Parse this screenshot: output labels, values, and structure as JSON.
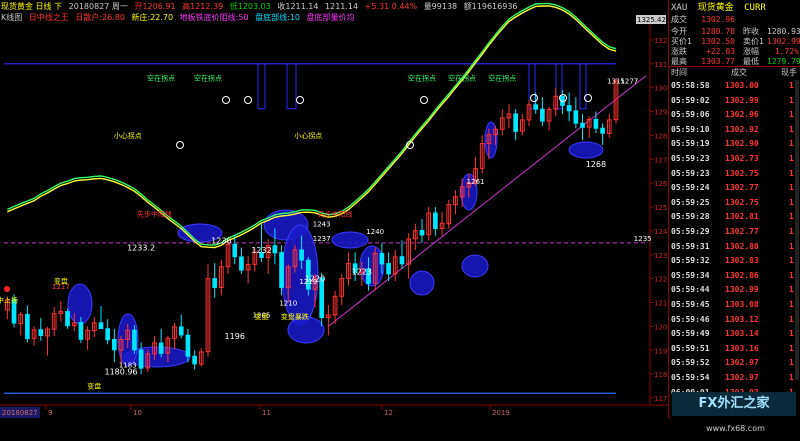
{
  "infobar": {
    "title": "现货黄金 日线 下",
    "date": "20180827 周一",
    "open": "开1206.91",
    "high": "高1212.39",
    "low": "低1203.03",
    "close": "收1211.14",
    "last": "1211.14",
    "change": "+5.31 0.44%",
    "volume": "量99138",
    "amount": "额119616936"
  },
  "indbar": {
    "name": "K线图",
    "sub": "日中线之王",
    "v1": "日散户:26.80",
    "v2": "新庄:22.70",
    "v3": "地板铁底价阻线:50",
    "v4": "盘底部线:10",
    "v5": "盘底部量价均"
  },
  "colors": {
    "bg": "#000000",
    "up": "#ff3333",
    "down": "#00e5ff",
    "ma_yellow": "#ffff33",
    "ma_green": "#33ff66",
    "blue_line": "#2a2aff",
    "mag_line": "#cc33cc",
    "ellipse": "#1a1acc",
    "axis_red": "#8b0000"
  },
  "chart_data": {
    "type": "candlestick",
    "y_range": [
      1170,
      1325
    ],
    "y_ticks": [
      1320,
      1310,
      1300,
      1290,
      1280,
      1270,
      1260,
      1250,
      1240,
      1230,
      1220,
      1210,
      1200,
      1190,
      1180,
      1170
    ],
    "top_value_label": "1325.42",
    "x_labels": [
      "20180827",
      "9",
      "10",
      "11",
      "12",
      "2019"
    ],
    "ohlc": [
      [
        1206.9,
        1212.4,
        1203.0,
        1211.1
      ],
      [
        1211.1,
        1213.5,
        1199.5,
        1201.4
      ],
      [
        1201.2,
        1206.0,
        1196.2,
        1205.0
      ],
      [
        1205.0,
        1208.8,
        1193.4,
        1194.9
      ],
      [
        1195.0,
        1200.0,
        1192.0,
        1198.5
      ],
      [
        1198.6,
        1203.5,
        1194.0,
        1196.2
      ],
      [
        1196.0,
        1199.8,
        1187.8,
        1198.9
      ],
      [
        1198.8,
        1208.2,
        1196.0,
        1205.3
      ],
      [
        1205.4,
        1210.6,
        1202.0,
        1206.3
      ],
      [
        1206.2,
        1207.5,
        1199.0,
        1200.3
      ],
      [
        1200.3,
        1205.5,
        1198.0,
        1201.5
      ],
      [
        1201.6,
        1204.0,
        1193.0,
        1194.6
      ],
      [
        1194.7,
        1200.1,
        1190.2,
        1198.3
      ],
      [
        1198.2,
        1203.9,
        1195.5,
        1201.5
      ],
      [
        1201.5,
        1208.5,
        1199.0,
        1199.1
      ],
      [
        1199.0,
        1203.0,
        1192.5,
        1194.4
      ],
      [
        1194.5,
        1199.0,
        1185.0,
        1190.2
      ],
      [
        1190.0,
        1196.0,
        1183.0,
        1194.5
      ],
      [
        1194.5,
        1201.0,
        1191.0,
        1198.4
      ],
      [
        1198.4,
        1200.5,
        1188.5,
        1190.2
      ],
      [
        1190.1,
        1193.3,
        1180.0,
        1182.5
      ],
      [
        1182.6,
        1190.2,
        1180.8,
        1188.5
      ],
      [
        1188.5,
        1196.0,
        1186.0,
        1193.1
      ],
      [
        1193.0,
        1199.0,
        1187.0,
        1188.7
      ],
      [
        1188.8,
        1196.0,
        1185.0,
        1195.0
      ],
      [
        1195.0,
        1201.5,
        1190.4,
        1199.8
      ],
      [
        1199.8,
        1205.0,
        1195.0,
        1196.4
      ],
      [
        1196.3,
        1199.0,
        1185.0,
        1187.5
      ],
      [
        1187.5,
        1190.0,
        1182.0,
        1184.3
      ],
      [
        1184.2,
        1191.0,
        1183.3,
        1189.3
      ],
      [
        1189.4,
        1226.0,
        1187.2,
        1220.0
      ],
      [
        1220.0,
        1226.5,
        1212.0,
        1216.3
      ],
      [
        1216.3,
        1228.0,
        1213.0,
        1225.0
      ],
      [
        1225.0,
        1236.0,
        1222.0,
        1234.3
      ],
      [
        1234.4,
        1238.5,
        1226.0,
        1229.2
      ],
      [
        1229.1,
        1233.0,
        1222.0,
        1223.6
      ],
      [
        1223.7,
        1229.5,
        1218.0,
        1225.9
      ],
      [
        1226.0,
        1233.0,
        1223.0,
        1231.1
      ],
      [
        1231.0,
        1243.0,
        1227.0,
        1228.9
      ],
      [
        1228.9,
        1236.5,
        1222.0,
        1233.8
      ],
      [
        1233.8,
        1241.0,
        1226.0,
        1230.8
      ],
      [
        1230.9,
        1234.0,
        1213.0,
        1216.3
      ],
      [
        1216.2,
        1226.0,
        1210.0,
        1224.9
      ],
      [
        1225.0,
        1234.0,
        1222.5,
        1232.1
      ],
      [
        1232.0,
        1238.0,
        1224.0,
        1227.8
      ],
      [
        1227.7,
        1229.0,
        1213.0,
        1215.6
      ],
      [
        1215.5,
        1222.0,
        1208.0,
        1220.3
      ],
      [
        1220.3,
        1222.5,
        1200.0,
        1203.7
      ],
      [
        1203.7,
        1209.0,
        1196.2,
        1204.8
      ],
      [
        1204.8,
        1215.0,
        1201.0,
        1212.6
      ],
      [
        1212.6,
        1222.0,
        1209.0,
        1220.0
      ],
      [
        1220.1,
        1231.0,
        1217.0,
        1226.3
      ],
      [
        1226.2,
        1231.0,
        1219.0,
        1222.5
      ],
      [
        1222.6,
        1227.0,
        1217.0,
        1224.0
      ],
      [
        1224.1,
        1229.0,
        1215.0,
        1218.0
      ],
      [
        1218.1,
        1233.0,
        1215.0,
        1230.6
      ],
      [
        1230.5,
        1235.0,
        1222.0,
        1226.2
      ],
      [
        1226.3,
        1231.0,
        1219.0,
        1222.0
      ],
      [
        1222.0,
        1232.0,
        1219.0,
        1229.1
      ],
      [
        1229.2,
        1236.0,
        1224.0,
        1226.2
      ],
      [
        1226.1,
        1239.0,
        1220.0,
        1236.6
      ],
      [
        1236.7,
        1243.0,
        1232.0,
        1240.1
      ],
      [
        1240.2,
        1245.0,
        1235.0,
        1238.3
      ],
      [
        1238.4,
        1250.0,
        1236.0,
        1247.5
      ],
      [
        1247.5,
        1250.0,
        1238.0,
        1241.0
      ],
      [
        1241.0,
        1248.0,
        1238.0,
        1243.2
      ],
      [
        1243.0,
        1253.0,
        1241.0,
        1251.0
      ],
      [
        1251.0,
        1257.0,
        1247.0,
        1254.3
      ],
      [
        1254.3,
        1262.0,
        1250.0,
        1258.5
      ],
      [
        1258.4,
        1264.0,
        1254.0,
        1260.3
      ],
      [
        1260.3,
        1271.0,
        1259.0,
        1266.1
      ],
      [
        1266.2,
        1280.0,
        1264.0,
        1276.6
      ],
      [
        1276.6,
        1283.0,
        1270.0,
        1280.3
      ],
      [
        1280.3,
        1284.0,
        1276.0,
        1282.6
      ],
      [
        1282.6,
        1291.0,
        1280.0,
        1287.3
      ],
      [
        1287.4,
        1293.0,
        1283.0,
        1289.0
      ],
      [
        1289.0,
        1291.0,
        1278.0,
        1281.7
      ],
      [
        1281.8,
        1289.0,
        1280.0,
        1286.5
      ],
      [
        1286.5,
        1295.0,
        1284.0,
        1292.8
      ],
      [
        1292.8,
        1298.0,
        1289.0,
        1291.0
      ],
      [
        1291.0,
        1296.0,
        1284.0,
        1286.0
      ],
      [
        1286.0,
        1292.0,
        1282.0,
        1290.9
      ],
      [
        1291.0,
        1300.0,
        1288.0,
        1296.4
      ],
      [
        1296.4,
        1299.0,
        1289.0,
        1292.6
      ],
      [
        1292.5,
        1298.0,
        1286.0,
        1290.3
      ],
      [
        1290.3,
        1296.0,
        1283.0,
        1285.1
      ],
      [
        1285.1,
        1289.0,
        1278.0,
        1283.4
      ],
      [
        1283.5,
        1288.0,
        1279.0,
        1286.7
      ],
      [
        1286.7,
        1290.0,
        1281.0,
        1283.0
      ],
      [
        1283.0,
        1285.0,
        1276.0,
        1280.9
      ],
      [
        1280.8,
        1289.0,
        1279.0,
        1286.5
      ],
      [
        1286.6,
        1304.0,
        1285.0,
        1302.9
      ]
    ],
    "ma_yellow": [
      1208,
      1207,
      1206,
      1205,
      1204,
      1204,
      1203.5,
      1203.5,
      1203.5,
      1203,
      1203,
      1202.5,
      1202,
      1202,
      1202,
      1201.5,
      1201,
      1200.5,
      1200,
      1199.5,
      1198.5,
      1197.5,
      1197,
      1196.5,
      1196,
      1196,
      1196,
      1195.5,
      1195,
      1195,
      1197,
      1199,
      1202,
      1206,
      1209,
      1212,
      1215,
      1218,
      1221,
      1223,
      1225,
      1226,
      1226.5,
      1227,
      1227.5,
      1227,
      1226,
      1224,
      1222,
      1221,
      1220.5,
      1220.5,
      1221,
      1221.5,
      1222,
      1223,
      1224,
      1225,
      1226,
      1227,
      1228.5,
      1230,
      1231.5,
      1233,
      1235,
      1237,
      1239,
      1241.5,
      1244,
      1247,
      1250.5,
      1254,
      1258,
      1262,
      1266,
      1270,
      1273,
      1276,
      1279,
      1282,
      1284,
      1286,
      1287.5,
      1288.5,
      1289,
      1289,
      1288.5,
      1288,
      1287.5,
      1287,
      1287,
      1288
    ],
    "ma_green": [
      1209,
      1208,
      1207,
      1206,
      1205,
      1205,
      1204.5,
      1204.5,
      1204.5,
      1204,
      1204,
      1203.5,
      1203,
      1203,
      1203,
      1202.5,
      1202,
      1201.5,
      1201,
      1200.5,
      1199.5,
      1198.5,
      1198,
      1197.5,
      1197,
      1197,
      1197,
      1196.5,
      1196,
      1196,
      1198,
      1200,
      1203,
      1207,
      1210,
      1213,
      1216,
      1219,
      1222,
      1224,
      1226,
      1227,
      1227.5,
      1228,
      1228.5,
      1228,
      1227,
      1225,
      1223,
      1222,
      1221.5,
      1221.5,
      1222,
      1222.5,
      1223,
      1224,
      1225,
      1226,
      1227,
      1228,
      1229.5,
      1231,
      1232.5,
      1234,
      1236,
      1238,
      1240,
      1242.5,
      1245,
      1248,
      1251.5,
      1255,
      1259,
      1263,
      1267,
      1271,
      1274,
      1277,
      1280,
      1283,
      1285,
      1287,
      1288.5,
      1289.5,
      1290,
      1290,
      1289.5,
      1289,
      1288.5,
      1288,
      1288,
      1289
    ],
    "blue_level": 1310,
    "blue_bottom_level": 1172,
    "mag_level": 1235,
    "mag_trend": {
      "from_index": 48,
      "from_value": 1200,
      "to_index": 100,
      "to_value": 1285
    },
    "ellipse_labels": [
      {
        "text": "1233.2",
        "i": 20,
        "v": 1233
      },
      {
        "text": "1236",
        "i": 32,
        "v": 1236
      },
      {
        "text": "1232",
        "i": 38,
        "v": 1232
      },
      {
        "text": "1220",
        "i": 46,
        "v": 1220
      },
      {
        "text": "1223",
        "i": 53,
        "v": 1223
      },
      {
        "text": "1196",
        "i": 34,
        "v": 1196
      },
      {
        "text": "1180.96",
        "i": 17,
        "v": 1181
      },
      {
        "text": "1268",
        "i": 88,
        "v": 1268
      }
    ],
    "price_labels": [
      {
        "text": "1217",
        "i": 8,
        "v": 1217,
        "color": "#ff3333"
      },
      {
        "text": "1183",
        "i": 18,
        "v": 1184,
        "color": "#ffffff"
      },
      {
        "text": "1205",
        "i": 38,
        "v": 1205,
        "color": "#ffffff"
      },
      {
        "text": "1210",
        "i": 42,
        "v": 1210,
        "color": "#ffffff"
      },
      {
        "text": "1219",
        "i": 45,
        "v": 1219,
        "color": "#ffffff"
      },
      {
        "text": "1237",
        "i": 47,
        "v": 1237,
        "color": "#ffffff"
      },
      {
        "text": "1240",
        "i": 55,
        "v": 1240,
        "color": "#ffffff"
      },
      {
        "text": "1243",
        "i": 47,
        "v": 1243,
        "color": "#ffffff"
      },
      {
        "text": "1261",
        "i": 70,
        "v": 1261,
        "color": "#ffffff"
      },
      {
        "text": "1235",
        "i": 95,
        "v": 1237,
        "color": "#ffffff"
      },
      {
        "text": "1315",
        "i": 91,
        "v": 1303,
        "color": "#ffffff"
      },
      {
        "text": "1277",
        "i": 93,
        "v": 1303,
        "color": "#ffffff"
      }
    ],
    "signal_labels": [
      {
        "text": "变盘",
        "i": 8,
        "v": 1218,
        "color": "#ffff00"
      },
      {
        "text": "变盘",
        "i": 13,
        "v": 1174,
        "color": "#ffff00"
      },
      {
        "text": "变盘",
        "i": 38,
        "v": 1203,
        "color": "#ffff00"
      },
      {
        "text": "变盘暴跌",
        "i": 43,
        "v": 1203,
        "color": "#ffff00"
      },
      {
        "text": "先步中阳线",
        "i": 22,
        "v": 1246,
        "color": "#ff3333"
      },
      {
        "text": "先步中阳线",
        "i": 49,
        "v": 1246,
        "color": "#ff3333"
      },
      {
        "text": "小心拐点",
        "i": 18,
        "v": 1279,
        "color": "#ffff00"
      },
      {
        "text": "小心拐点",
        "i": 45,
        "v": 1279,
        "color": "#ffff00"
      },
      {
        "text": "空在拐点",
        "i": 23,
        "v": 1303,
        "color": "#33ff66"
      },
      {
        "text": "空在拐点",
        "i": 30,
        "v": 1303,
        "color": "#33ff66"
      },
      {
        "text": "空在拐点",
        "i": 62,
        "v": 1303,
        "color": "#33ff66"
      },
      {
        "text": "空在拐点",
        "i": 68,
        "v": 1303,
        "color": "#33ff66"
      },
      {
        "text": "空在拐点",
        "i": 74,
        "v": 1303,
        "color": "#33ff66"
      },
      {
        "text": "中上扬",
        "i": 0,
        "v": 1210,
        "color": "#ffff00"
      }
    ]
  },
  "panel": {
    "header": {
      "symbol": "XAU",
      "name": "现货黄金",
      "code": "CURR"
    },
    "last_label": "成交",
    "last_value": "1302.96",
    "rows": [
      {
        "k": "今开",
        "v": "1280.78",
        "vc": "red",
        "k2": "昨收",
        "v2": "1280.93",
        "v2c": ""
      },
      {
        "k": "买价1",
        "v": "1302.50",
        "vc": "red",
        "k2": "卖价1",
        "v2": "1302.99",
        "v2c": "red"
      },
      {
        "k": "涨跌",
        "v": "+22.03",
        "vc": "red",
        "k2": "涨幅",
        "v2": "1.72%",
        "v2c": "red"
      },
      {
        "k": "最高",
        "v": "1303.77",
        "vc": "red",
        "k2": "最低",
        "v2": "1279.79",
        "v2c": "green"
      }
    ],
    "thead": {
      "time": "时间",
      "price": "成交",
      "vol": "现手"
    },
    "ticks": [
      {
        "time": "05:58:58",
        "price": "1303.00",
        "vol": "1"
      },
      {
        "time": "05:59:02",
        "price": "1302.99",
        "vol": "1"
      },
      {
        "time": "05:59:06",
        "price": "1302.96",
        "vol": "1"
      },
      {
        "time": "05:59:10",
        "price": "1302.92",
        "vol": "1"
      },
      {
        "time": "05:59:19",
        "price": "1302.90",
        "vol": "1"
      },
      {
        "time": "05:59:23",
        "price": "1302.73",
        "vol": "1"
      },
      {
        "time": "05:59:23",
        "price": "1302.75",
        "vol": "1"
      },
      {
        "time": "05:59:24",
        "price": "1302.77",
        "vol": "1"
      },
      {
        "time": "05:59:25",
        "price": "1302.75",
        "vol": "1"
      },
      {
        "time": "05:59:28",
        "price": "1302.81",
        "vol": "1"
      },
      {
        "time": "05:59:29",
        "price": "1302.77",
        "vol": "1"
      },
      {
        "time": "05:59:31",
        "price": "1302.80",
        "vol": "1"
      },
      {
        "time": "05:59:32",
        "price": "1302.83",
        "vol": "1"
      },
      {
        "time": "05:59:34",
        "price": "1302.86",
        "vol": "1"
      },
      {
        "time": "05:59:44",
        "price": "1302.99",
        "vol": "1"
      },
      {
        "time": "05:59:45",
        "price": "1303.08",
        "vol": "1"
      },
      {
        "time": "05:59:46",
        "price": "1303.12",
        "vol": "1"
      },
      {
        "time": "05:59:49",
        "price": "1303.14",
        "vol": "1"
      },
      {
        "time": "05:59:51",
        "price": "1303.16",
        "vol": "1"
      },
      {
        "time": "05:59:52",
        "price": "1302.97",
        "vol": "1"
      },
      {
        "time": "05:59:54",
        "price": "1302.97",
        "vol": "1"
      },
      {
        "time": "06:00:01",
        "price": "1302.93",
        "vol": "1"
      }
    ]
  },
  "logo": {
    "text": "FX外汇之家",
    "url": "www.fx68.com"
  }
}
